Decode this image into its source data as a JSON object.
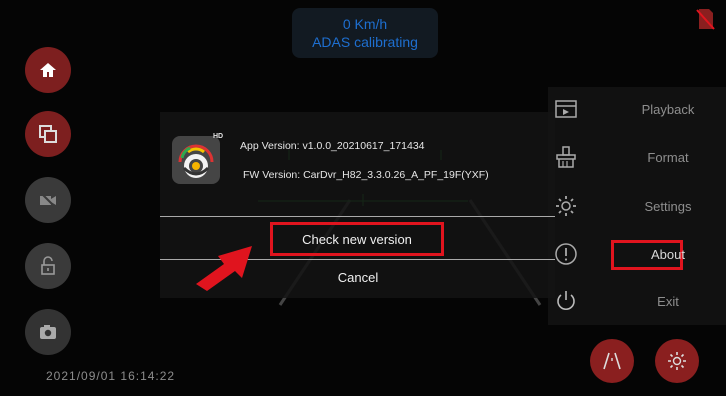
{
  "status": {
    "speed": "0 Km/h",
    "adas": "ADAS calibrating"
  },
  "sd_icon": "no-sdcard-icon",
  "left_buttons": [
    {
      "name": "home-icon",
      "color": "#7d1f1f"
    },
    {
      "name": "copy-icon",
      "color": "#7d1f1f"
    },
    {
      "name": "video-off-icon",
      "color": "#3a3a3a"
    },
    {
      "name": "unlock-icon",
      "color": "#3a3a3a"
    },
    {
      "name": "camera-icon",
      "color": "#333333"
    }
  ],
  "datetime": "2021/09/01   16:14:22",
  "menu": {
    "items": [
      {
        "label": "Playback",
        "icon": "playback-icon"
      },
      {
        "label": "Format",
        "icon": "format-icon"
      },
      {
        "label": "Settings",
        "icon": "settings-icon"
      },
      {
        "label": "About",
        "icon": "about-icon"
      },
      {
        "label": "Exit",
        "icon": "exit-icon"
      }
    ],
    "highlighted": "About"
  },
  "bottom_buttons": [
    {
      "name": "lane-icon"
    },
    {
      "name": "gear-icon"
    }
  ],
  "dialog": {
    "app_icon_badge": "HD",
    "app_version": "App Version:  v1.0.0_20210617_171434",
    "fw_version": "FW Version:  CarDvr_H82_3.3.0.26_A_PF_19F(YXF)",
    "check_label": "Check new version",
    "cancel_label": "Cancel"
  },
  "colors": {
    "accent_red": "#e0141e",
    "status_blue": "#1e6fd0"
  }
}
